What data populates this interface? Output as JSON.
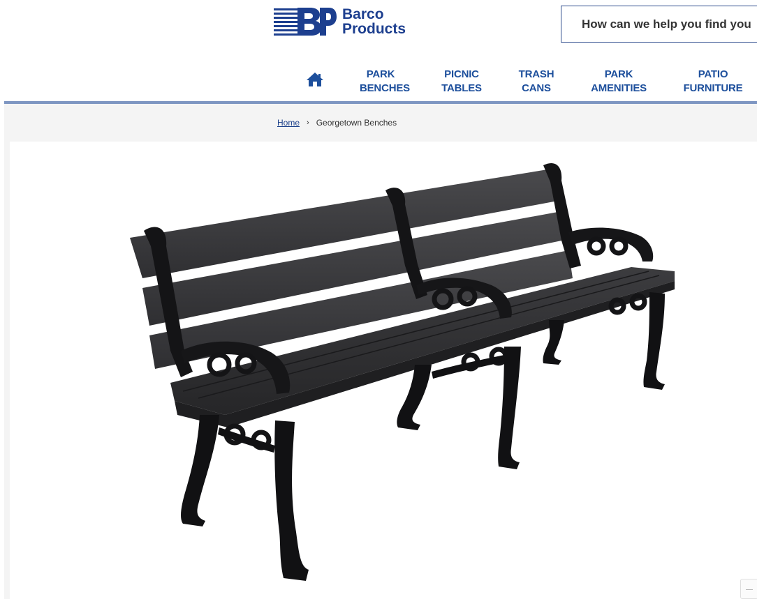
{
  "brand": {
    "logo_mark": "BP",
    "line1": "Barco",
    "line2": "Products",
    "color": "#1d3f8f"
  },
  "search": {
    "placeholder": "How can we help you find you"
  },
  "nav": {
    "home_icon": "home-icon",
    "items": [
      {
        "line1": "PARK",
        "line2": "BENCHES"
      },
      {
        "line1": "PICNIC",
        "line2": "TABLES"
      },
      {
        "line1": "TRASH",
        "line2": "CANS"
      },
      {
        "line1": "PARK",
        "line2": "AMENITIES"
      },
      {
        "line1": "PATIO",
        "line2": "FURNITURE"
      }
    ],
    "link_color": "#1d4f9c",
    "bar_color": "#7e96c2"
  },
  "breadcrumb": {
    "home": "Home",
    "separator": "›",
    "current": "Georgetown Benches"
  },
  "product": {
    "image_icon": "bench-image"
  }
}
